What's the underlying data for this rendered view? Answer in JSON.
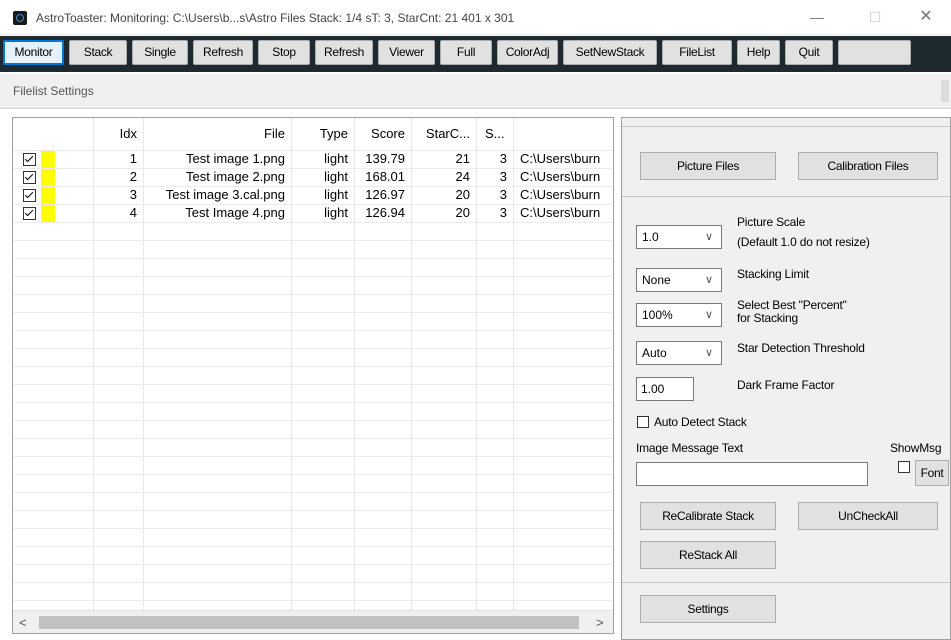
{
  "window": {
    "title": "AstroToaster: Monitoring: C:\\Users\\b...s\\Astro Files   Stack: 1/4 sT: 3, StarCnt: 21   401 x 301",
    "min_glyph": "—",
    "max_glyph": "☐",
    "close_glyph": "✕"
  },
  "toolbar": {
    "buttons": [
      "Monitor",
      "Stack",
      "Single",
      "Refresh",
      "Stop",
      "Refresh",
      "Viewer",
      "Full",
      "ColorAdj",
      "SetNewStack",
      "FileList",
      "Help",
      "Quit",
      ""
    ],
    "active": "Monitor"
  },
  "settings_bar": {
    "label": "Filelist Settings"
  },
  "grid": {
    "columns": [
      "Idx",
      "File",
      "Type",
      "Score",
      "StarC...",
      "S...",
      ""
    ],
    "rows": [
      {
        "checked": true,
        "color": "#ffff00",
        "idx": "1",
        "file": "Test image 1.png",
        "type": "light",
        "score": "139.79",
        "starc": "21",
        "s": "3",
        "path": "C:\\Users\\burn"
      },
      {
        "checked": true,
        "color": "#ffff00",
        "idx": "2",
        "file": "Test image 2.png",
        "type": "light",
        "score": "168.01",
        "starc": "24",
        "s": "3",
        "path": "C:\\Users\\burn"
      },
      {
        "checked": true,
        "color": "#ffff00",
        "idx": "3",
        "file": "Test image 3.cal.png",
        "type": "light",
        "score": "126.97",
        "starc": "20",
        "s": "3",
        "path": "C:\\Users\\burn"
      },
      {
        "checked": true,
        "color": "#ffff00",
        "idx": "4",
        "file": "Test Image 4.png",
        "type": "light",
        "score": "126.94",
        "starc": "20",
        "s": "3",
        "path": "C:\\Users\\burn"
      }
    ],
    "scroll_left": "<",
    "scroll_right": ">"
  },
  "panel": {
    "picture_files": "Picture Files",
    "calibration_files": "Calibration Files",
    "picture_scale": {
      "value": "1.0",
      "label": "Picture Scale",
      "hint": "(Default 1.0 do not resize)"
    },
    "stacking_limit": {
      "value": "None",
      "label": "Stacking Limit"
    },
    "best_percent": {
      "value": "100%",
      "label_line1": "Select Best \"Percent\"",
      "label_line2": "for Stacking"
    },
    "star_threshold": {
      "value": "Auto",
      "label": "Star Detection Threshold"
    },
    "dark_factor": {
      "value": "1.00",
      "label": "Dark Frame Factor"
    },
    "auto_detect": {
      "label": "Auto Detect Stack",
      "checked": false
    },
    "image_message": {
      "label": "Image Message Text",
      "value": ""
    },
    "show_msg": {
      "label": "ShowMsg",
      "checked": false
    },
    "font_button": "Font",
    "recalibrate": "ReCalibrate Stack",
    "uncheck_all": "UnCheckAll",
    "restack_all": "ReStack All",
    "settings": "Settings"
  },
  "colors": {
    "accent": "#0078d7",
    "toolbar_bg": "#1f2a30",
    "flag_yellow": "#ffff00"
  }
}
